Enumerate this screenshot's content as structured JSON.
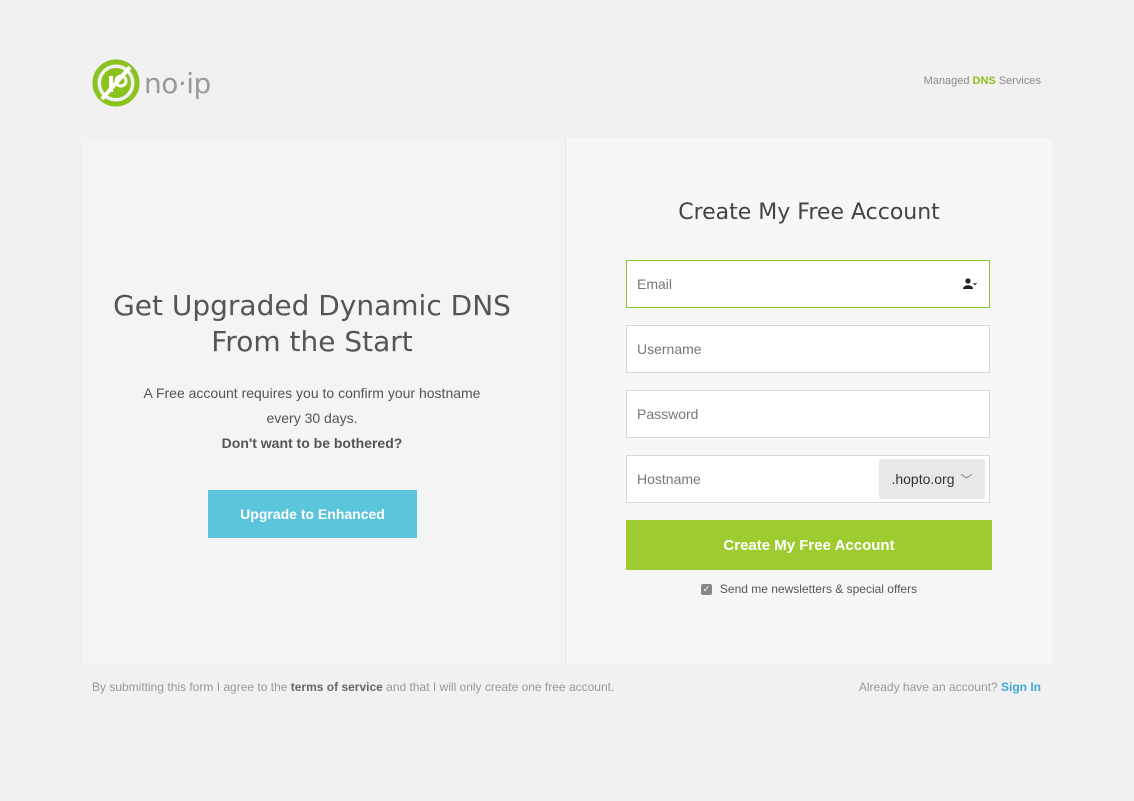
{
  "header": {
    "logo_text": "no·ip",
    "tagline_prefix": "Managed",
    "tagline_highlight": "DNS",
    "tagline_suffix": "Services"
  },
  "promo": {
    "title": "Get Upgraded Dynamic DNS From the Start",
    "desc": "A Free account requires you to confirm your hostname every 30 days.",
    "desc_bold": "Don't want to be bothered?",
    "upgrade_label": "Upgrade to Enhanced"
  },
  "form": {
    "title": "Create My Free Account",
    "email_placeholder": "Email",
    "username_placeholder": "Username",
    "password_placeholder": "Password",
    "hostname_placeholder": "Hostname",
    "domain": ".hopto.org",
    "submit_label": "Create My Free Account",
    "newsletter_label": "Send me newsletters & special offers",
    "newsletter_checked": true
  },
  "footer": {
    "terms_prefix": "By submitting this form I agree to the",
    "terms_link": "terms of service",
    "terms_suffix": "and that I will only create one free account.",
    "signin_prefix": "Already have an account?",
    "signin_link": "Sign In"
  },
  "colors": {
    "brand_green": "#8bc21e",
    "button_green": "#9ecb2f",
    "button_blue": "#5bc5db",
    "link_blue": "#3fa7d9"
  }
}
